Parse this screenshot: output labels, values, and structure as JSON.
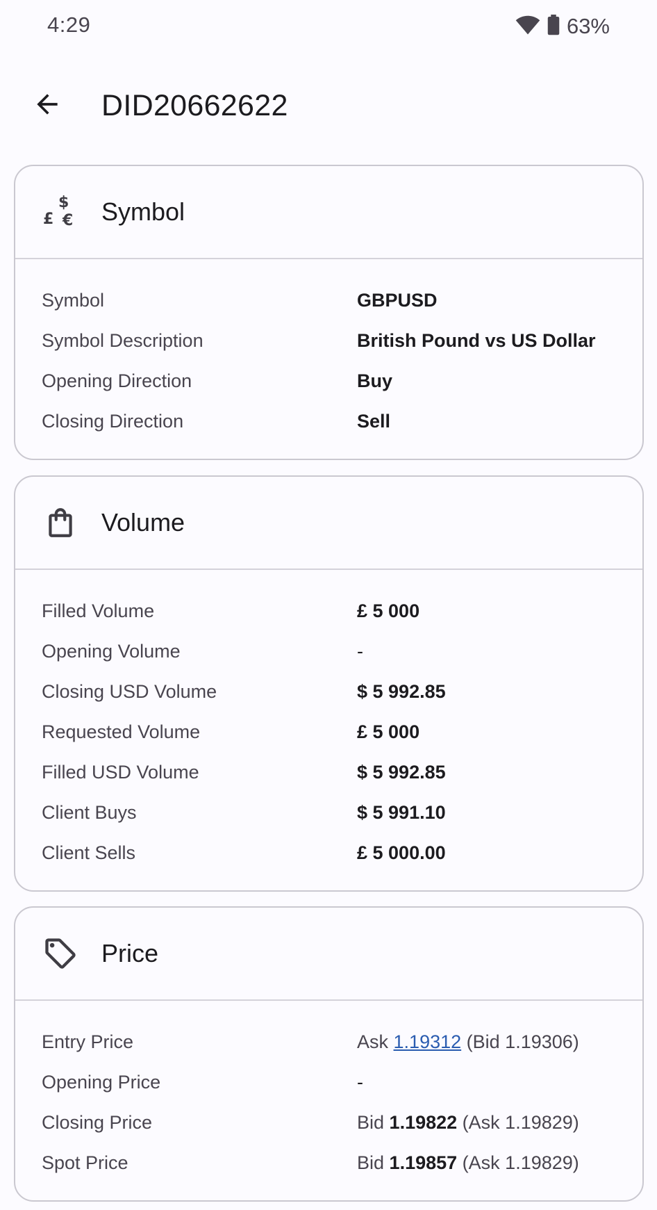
{
  "status": {
    "time": "4:29",
    "battery": "63%",
    "icons": [
      "wifi-icon",
      "battery-icon"
    ]
  },
  "app_bar": {
    "title": "DID20662622",
    "back_icon": "arrow-back-icon"
  },
  "cards": {
    "symbol": {
      "title": "Symbol",
      "icon": "currency-exchange-icon",
      "rows": [
        {
          "label": "Symbol",
          "value": "GBPUSD"
        },
        {
          "label": "Symbol Description",
          "value": "British Pound vs US Dollar"
        },
        {
          "label": "Opening Direction",
          "value": "Buy"
        },
        {
          "label": "Closing Direction",
          "value": "Sell"
        }
      ]
    },
    "volume": {
      "title": "Volume",
      "icon": "shopping-bag-icon",
      "rows": [
        {
          "label": "Filled Volume",
          "value": "£ 5 000"
        },
        {
          "label": "Opening Volume",
          "value": "-"
        },
        {
          "label": "Closing USD Volume",
          "value": "$ 5 992.85"
        },
        {
          "label": "Requested Volume",
          "value": "£ 5 000"
        },
        {
          "label": "Filled USD Volume",
          "value": "$ 5 992.85"
        },
        {
          "label": "Client Buys",
          "value": "$ 5 991.10"
        },
        {
          "label": "Client Sells",
          "value": "£ 5 000.00"
        }
      ]
    },
    "price": {
      "title": "Price",
      "icon": "tag-icon",
      "rows": [
        {
          "label": "Entry Price",
          "prefix": "Ask",
          "main": "1.19312",
          "suffix": "(Bid 1.19306)"
        },
        {
          "label": "Opening Price",
          "value": "-"
        },
        {
          "label": "Closing Price",
          "prefix": "Bid",
          "main": "1.19822",
          "suffix": "(Ask 1.19829)"
        },
        {
          "label": "Spot Price",
          "prefix": "Bid",
          "main": "1.19857",
          "suffix": "(Ask 1.19829)"
        }
      ]
    }
  },
  "colors": {
    "background": "#fcfbff",
    "card_border": "#cac8d0",
    "label": "#49454f",
    "value": "#1c1b1f",
    "link": "#2a5cb0"
  }
}
